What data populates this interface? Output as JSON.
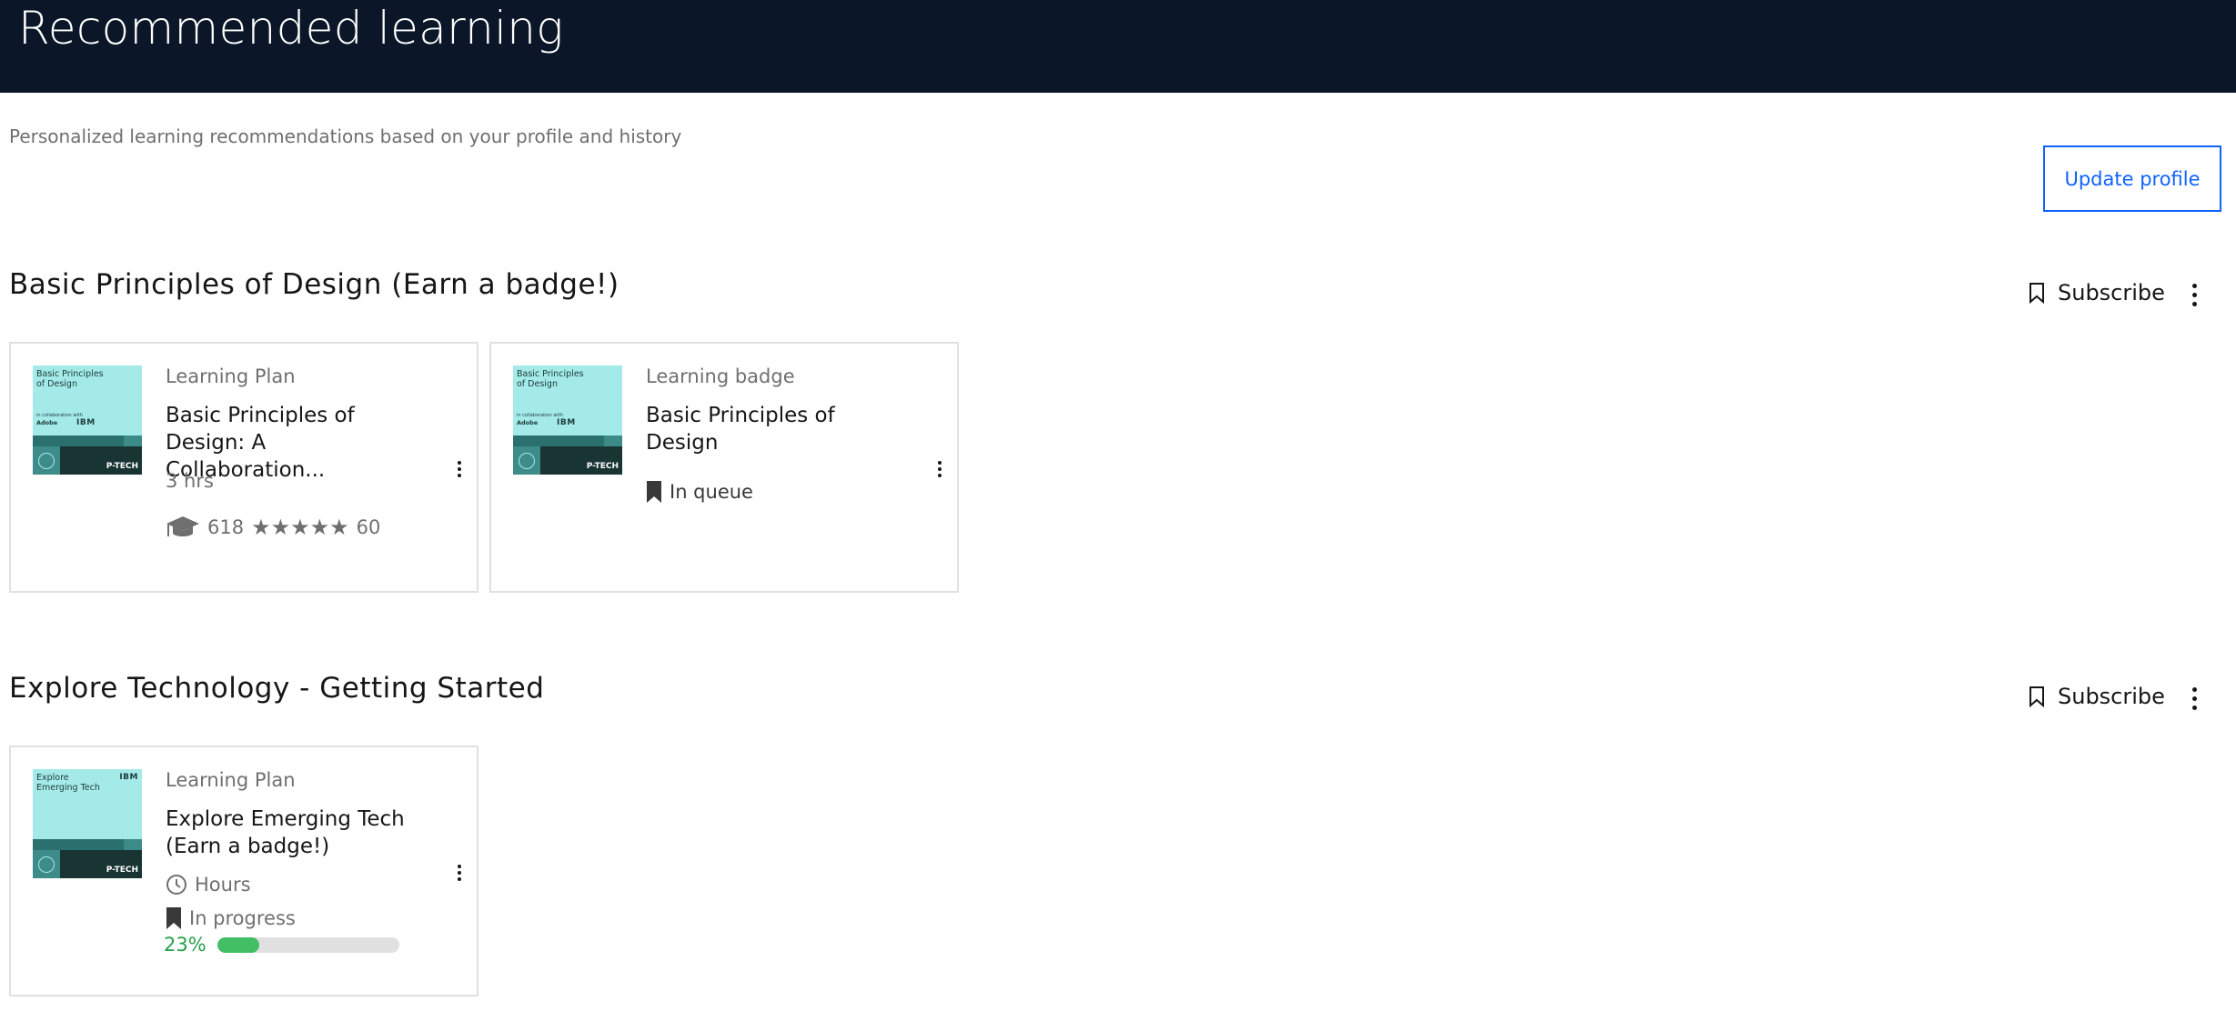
{
  "header": {
    "title": "Recommended learning"
  },
  "intro": {
    "subtitle": "Personalized learning recommendations based on your profile and history",
    "update_button": "Update profile"
  },
  "colors": {
    "banner": "#0b1728",
    "accent": "#0f62fe",
    "progress": "#42be65"
  },
  "sections": [
    {
      "title": "Basic Principles of Design (Earn a badge!)",
      "subscribe_label": "Subscribe",
      "cards": [
        {
          "type": "Learning Plan",
          "title": "Basic Principles of Design: A Collaboration...",
          "duration": "3 hrs",
          "learners": "618",
          "rating_count": "60",
          "thumb": {
            "title": "Basic Principles of Design",
            "collab": "in collaboration with",
            "adobe": "Adobe",
            "ibm": "IBM",
            "ptech": "P-TECH"
          }
        },
        {
          "type": "Learning badge",
          "title": "Basic Principles of Design",
          "status": "In queue",
          "thumb": {
            "title": "Basic Principles of Design",
            "collab": "in collaboration with",
            "adobe": "Adobe",
            "ibm": "IBM",
            "ptech": "P-TECH"
          }
        }
      ]
    },
    {
      "title": "Explore Technology - Getting Started",
      "subscribe_label": "Subscribe",
      "cards": [
        {
          "type": "Learning Plan",
          "title": "Explore Emerging Tech (Earn a badge!)",
          "duration": "Hours",
          "status": "In progress",
          "progress_label": "23%",
          "progress": 0.23,
          "thumb": {
            "title": "Explore Emerging Tech",
            "ibm": "IBM",
            "ptech": "P-TECH"
          }
        }
      ]
    }
  ]
}
